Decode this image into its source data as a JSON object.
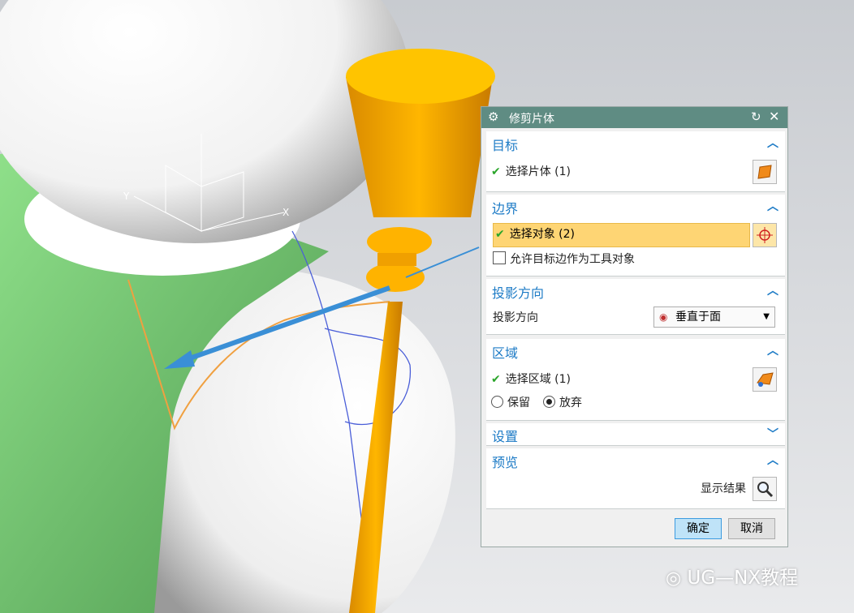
{
  "dialog": {
    "title": "修剪片体",
    "title_icon": "gear-icon",
    "reset_icon": "reset-icon",
    "close_icon": "close-icon",
    "accent": "#1d7bc6",
    "title_color": "#5f8c83"
  },
  "sections": {
    "target": {
      "title": "目标",
      "select_label": "选择片体 (1)"
    },
    "boundary": {
      "title": "边界",
      "select_label": "选择对象 (2)",
      "allow_label": "允许目标边作为工具对象"
    },
    "projection": {
      "title": "投影方向",
      "label": "投影方向",
      "value": "垂直于面"
    },
    "region": {
      "title": "区域",
      "select_label": "选择区域 (1)",
      "keep_label": "保留",
      "discard_label": "放弃",
      "selected": "放弃"
    },
    "settings": {
      "title": "设置"
    },
    "preview": {
      "title": "预览",
      "show_result_label": "显示结果"
    }
  },
  "buttons": {
    "ok": "确定",
    "cancel": "取消"
  },
  "viewport": {
    "axis_x": "X",
    "axis_y": "Y"
  },
  "watermark": {
    "text": "UG—NX教程"
  }
}
